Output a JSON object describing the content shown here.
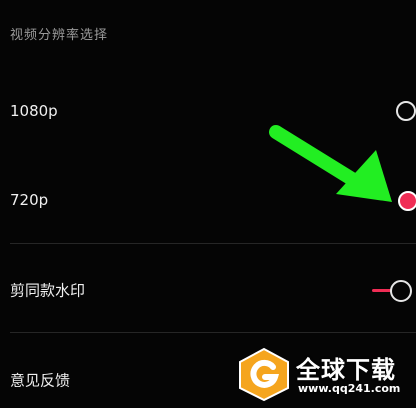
{
  "section_title": "视频分辨率选择",
  "resolution_options": [
    {
      "label": "1080p",
      "selected": false
    },
    {
      "label": "720p",
      "selected": true
    }
  ],
  "watermark_setting": {
    "label": "剪同款水印",
    "enabled": true
  },
  "feedback": {
    "label": "意见反馈"
  },
  "overlay_watermark": {
    "title": "全球下载",
    "url": "www.qq241.com"
  },
  "colors": {
    "accent": "#f02d55",
    "annotation_arrow": "#22ee22",
    "background": "#050505"
  },
  "icons": {
    "annotation": "arrow-down-right-icon",
    "watermark_logo": "download-site-logo-icon"
  }
}
